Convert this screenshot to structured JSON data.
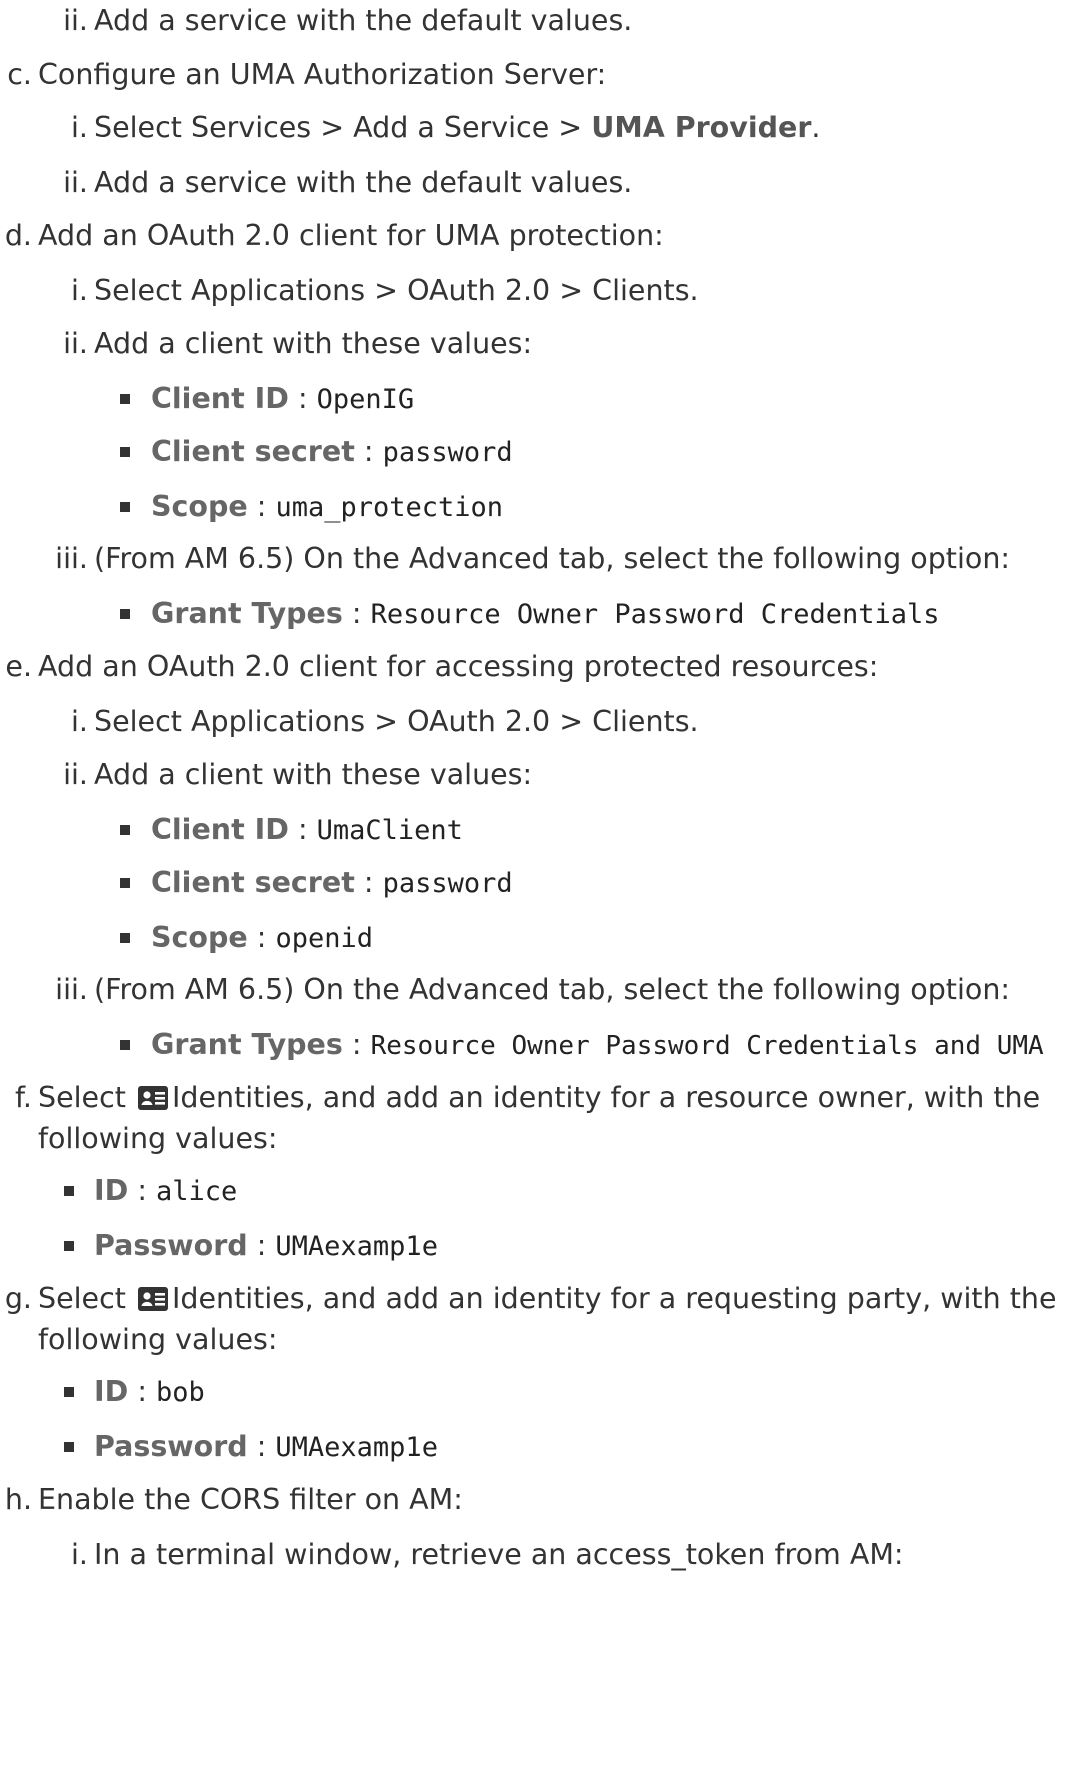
{
  "steps": {
    "b_ii": {
      "marker": "ii.",
      "text": "Add a service with the default values."
    },
    "c": {
      "marker": "c.",
      "text": "Configure an UMA Authorization Server:"
    },
    "c_i": {
      "marker": "i.",
      "text": "Select Services > Add a Service > ",
      "bold": "UMA Provider",
      "end": "."
    },
    "c_ii": {
      "marker": "ii.",
      "text": "Add a service with the default values."
    },
    "d": {
      "marker": "d.",
      "text": "Add an OAuth 2.0 client for UMA protection:"
    },
    "d_i": {
      "marker": "i.",
      "text": "Select Applications > OAuth 2.0 > Clients."
    },
    "d_ii": {
      "marker": "ii.",
      "text": "Add a client with these values:"
    },
    "d_ii_fields": [
      {
        "label": "Client ID",
        "value": "OpenIG"
      },
      {
        "label": "Client secret",
        "value": "password"
      },
      {
        "label": "Scope",
        "value": "uma_protection"
      }
    ],
    "d_iii": {
      "marker": "iii.",
      "text": "(From AM 6.5) On the Advanced tab, select the following option:"
    },
    "d_iii_field": {
      "label": "Grant Types",
      "value": "Resource Owner Password Credentials"
    },
    "e": {
      "marker": "e.",
      "text": "Add an OAuth 2.0 client for accessing protected resources:"
    },
    "e_i": {
      "marker": "i.",
      "text": "Select Applications > OAuth 2.0 > Clients."
    },
    "e_ii": {
      "marker": "ii.",
      "text": "Add a client with these values:"
    },
    "e_ii_fields": [
      {
        "label": "Client ID",
        "value": "UmaClient"
      },
      {
        "label": "Client secret",
        "value": "password"
      },
      {
        "label": "Scope",
        "value": "openid"
      }
    ],
    "e_iii": {
      "marker": "iii.",
      "text": "(From AM 6.5) On the Advanced tab, select the following option:"
    },
    "e_iii_field": {
      "label": "Grant Types",
      "value": "Resource Owner Password Credentials and UMA"
    },
    "f": {
      "marker": "f.",
      "pre": "Select",
      "post": "Identities, and add an identity for a resource owner, with the",
      "cont": "following values:",
      "icon": "id-card-icon"
    },
    "f_fields": [
      {
        "label": "ID",
        "value": "alice"
      },
      {
        "label": "Password",
        "value": "UMAexamp1e"
      }
    ],
    "g": {
      "marker": "g.",
      "pre": "Select",
      "post": "Identities, and add an identity for a requesting party, with the",
      "cont": "following values:",
      "icon": "id-card-icon"
    },
    "g_fields": [
      {
        "label": "ID",
        "value": "bob"
      },
      {
        "label": "Password",
        "value": "UMAexamp1e"
      }
    ],
    "h": {
      "marker": "h.",
      "text": "Enable the CORS filter on AM:"
    },
    "h_i": {
      "marker": "i.",
      "text": "In a terminal window, retrieve an access_token from AM:"
    }
  }
}
